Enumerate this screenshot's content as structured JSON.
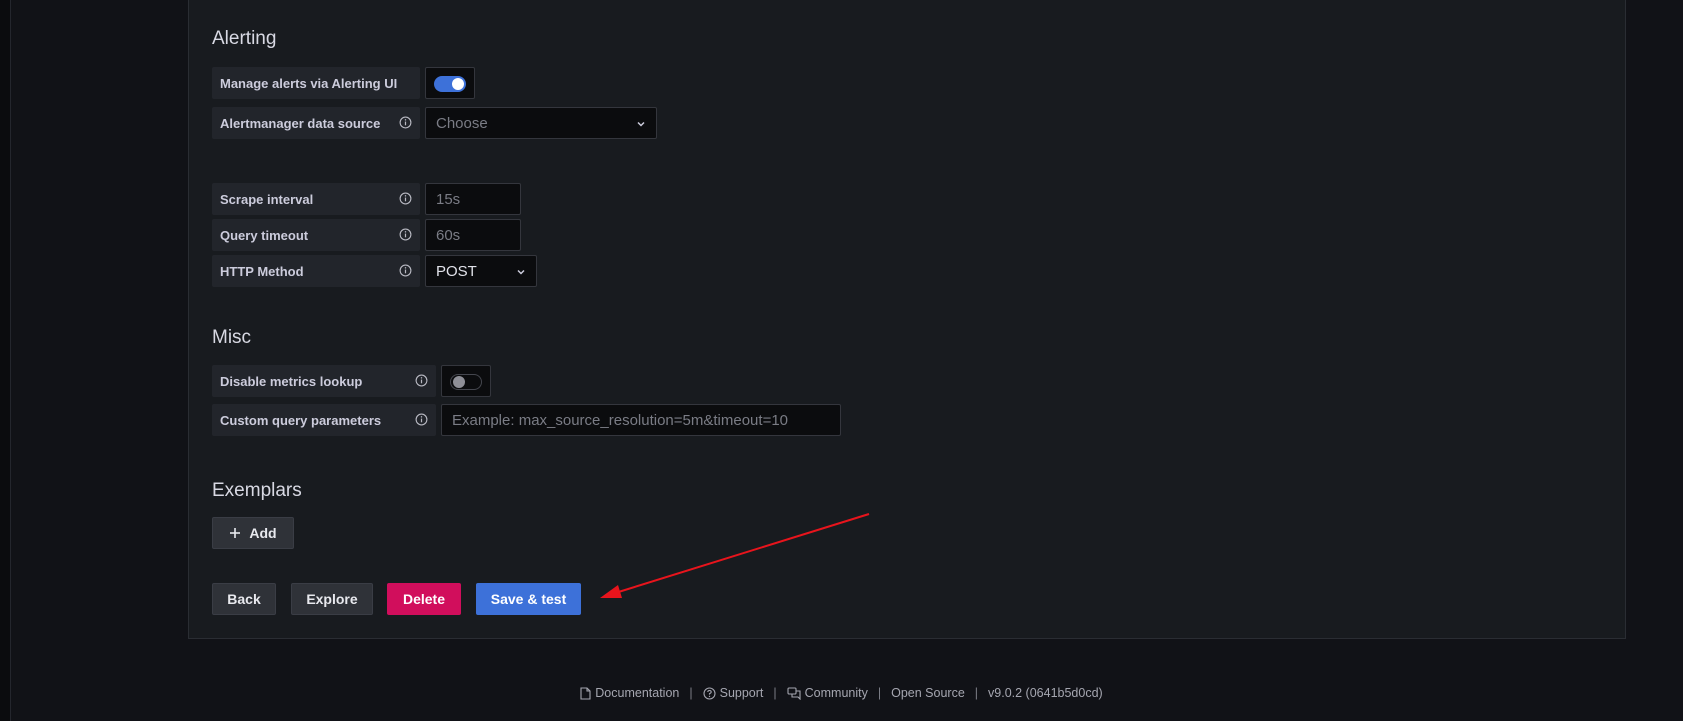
{
  "alerting": {
    "title": "Alerting",
    "manage_alerts_label": "Manage alerts via Alerting UI",
    "manage_alerts_enabled": true,
    "alertmanager_label": "Alertmanager data source",
    "alertmanager_placeholder": "Choose"
  },
  "interval": {
    "scrape_label": "Scrape interval",
    "scrape_placeholder": "15s",
    "timeout_label": "Query timeout",
    "timeout_placeholder": "60s",
    "http_method_label": "HTTP Method",
    "http_method_value": "POST"
  },
  "misc": {
    "title": "Misc",
    "disable_metrics_label": "Disable metrics lookup",
    "disable_metrics_enabled": false,
    "custom_query_label": "Custom query parameters",
    "custom_query_placeholder": "Example: max_source_resolution=5m&timeout=10"
  },
  "exemplars": {
    "title": "Exemplars",
    "add_label": "Add"
  },
  "actions": {
    "back": "Back",
    "explore": "Explore",
    "delete": "Delete",
    "save_test": "Save & test"
  },
  "footer": {
    "documentation": "Documentation",
    "support": "Support",
    "community": "Community",
    "open_source": "Open Source",
    "version": "v9.0.2 (0641b5d0cd)",
    "separator": "|"
  },
  "colors": {
    "primary": "#3d71d9",
    "danger": "#d10e5c",
    "annotation_arrow": "#e8141c"
  }
}
